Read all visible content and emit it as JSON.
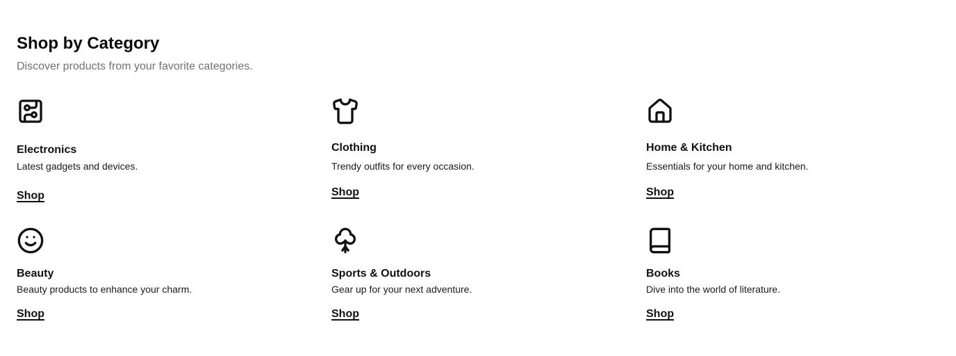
{
  "header": {
    "title": "Shop by Category",
    "subtitle": "Discover products from your favorite categories."
  },
  "categories": [
    {
      "icon": "circuit-board-icon",
      "title": "Electronics",
      "description": "Latest gadgets and devices.",
      "link_label": "Shop"
    },
    {
      "icon": "shirt-icon",
      "title": "Clothing",
      "description": "Trendy outfits for every occasion.",
      "link_label": "Shop"
    },
    {
      "icon": "home-icon",
      "title": "Home & Kitchen",
      "description": "Essentials for your home and kitchen.",
      "link_label": "Shop"
    },
    {
      "icon": "smile-icon",
      "title": "Beauty",
      "description": "Beauty products to enhance your charm.",
      "link_label": "Shop"
    },
    {
      "icon": "clover-icon",
      "title": "Sports & Outdoors",
      "description": "Gear up for your next adventure.",
      "link_label": "Shop"
    },
    {
      "icon": "book-icon",
      "title": "Books",
      "description": "Dive into the world of literature.",
      "link_label": "Shop"
    }
  ]
}
